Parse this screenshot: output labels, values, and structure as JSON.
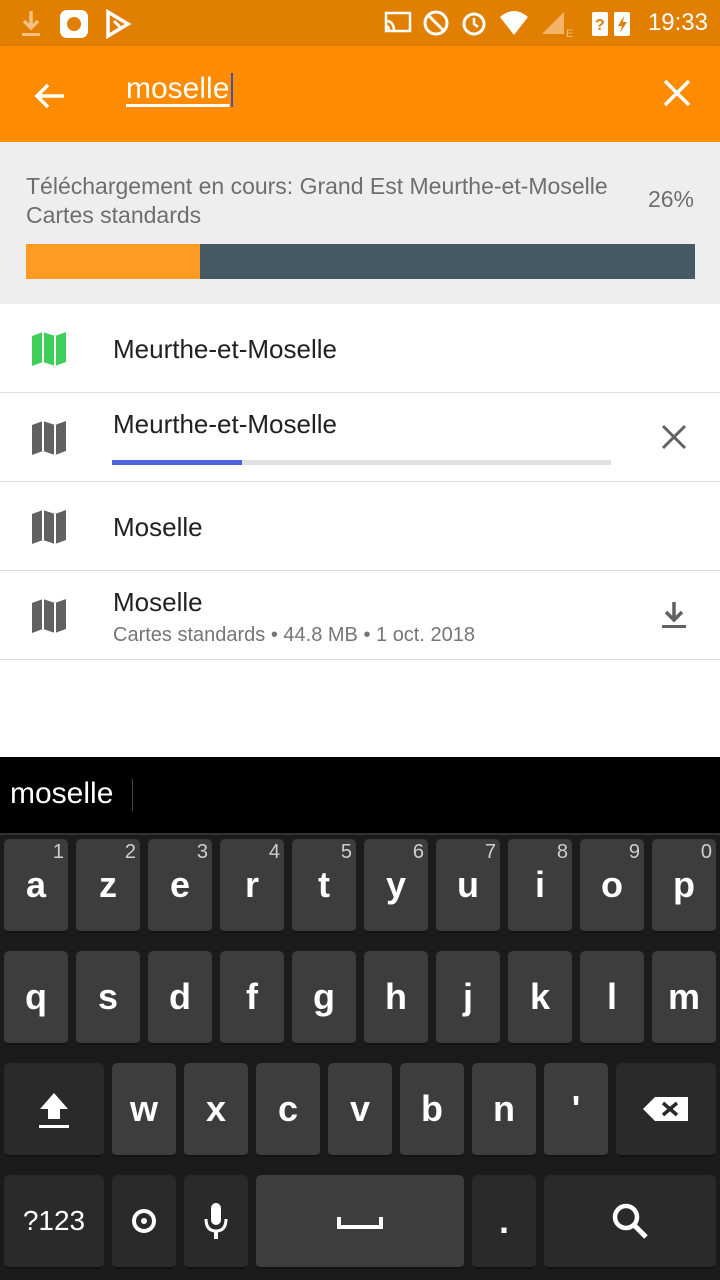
{
  "status_bar": {
    "time": "19:33",
    "icons": [
      "download-icon",
      "app-icon",
      "play-store-icon",
      "cast-icon",
      "dnd-icon",
      "alarm-icon",
      "wifi-icon",
      "signal-icon",
      "battery-icon"
    ]
  },
  "toolbar": {
    "search_value": "moselle"
  },
  "download": {
    "text": "Téléchargement en cours: Grand Est Meurthe-et-Moselle Cartes standards",
    "percent_label": "26%",
    "progress": 0.26,
    "colors": {
      "fill": "#ff9a22",
      "track": "#455a64"
    }
  },
  "results": [
    {
      "title": "Meurthe-et-Moselle",
      "icon": "map-icon",
      "icon_color": "#3ecf5a",
      "state": "downloaded"
    },
    {
      "title": "Meurthe-et-Moselle",
      "icon": "map-icon",
      "icon_color": "#616161",
      "state": "downloading",
      "progress": 0.26,
      "action_icon": "cancel-icon"
    },
    {
      "title": "Moselle",
      "icon": "map-icon",
      "icon_color": "#616161",
      "state": "none"
    },
    {
      "title": "Moselle",
      "subtitle": "Cartes standards • 44.8 MB • 1 oct. 2018",
      "icon": "map-icon",
      "icon_color": "#616161",
      "state": "available",
      "action_icon": "download-icon"
    }
  ],
  "keyboard": {
    "suggestion": "moselle",
    "row1": [
      {
        "k": "a",
        "h": "1"
      },
      {
        "k": "z",
        "h": "2"
      },
      {
        "k": "e",
        "h": "3"
      },
      {
        "k": "r",
        "h": "4"
      },
      {
        "k": "t",
        "h": "5"
      },
      {
        "k": "y",
        "h": "6"
      },
      {
        "k": "u",
        "h": "7"
      },
      {
        "k": "i",
        "h": "8"
      },
      {
        "k": "o",
        "h": "9"
      },
      {
        "k": "p",
        "h": "0"
      }
    ],
    "row2": [
      "q",
      "s",
      "d",
      "f",
      "g",
      "h",
      "j",
      "k",
      "l",
      "m"
    ],
    "row3": [
      "w",
      "x",
      "c",
      "v",
      "b",
      "n",
      "'"
    ],
    "symbols_label": "?123",
    "period_label": "."
  },
  "theme": {
    "primary": "#ff8c00",
    "status_bar": "#e07f00"
  }
}
